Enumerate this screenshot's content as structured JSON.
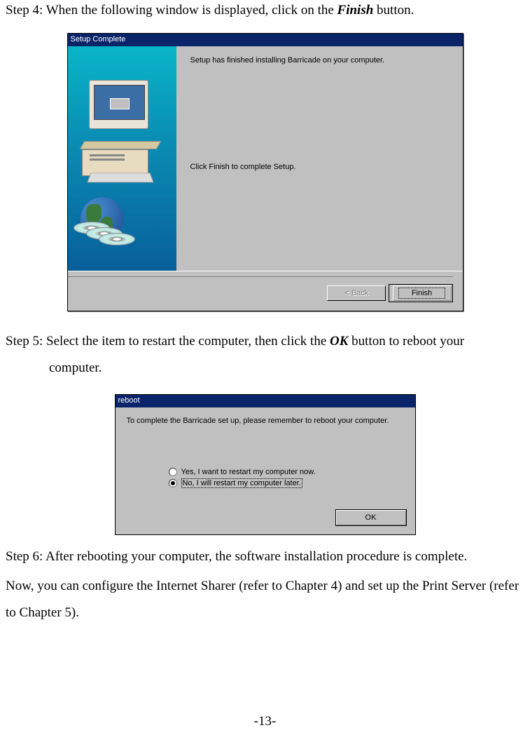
{
  "step4": {
    "prefix": "Step 4: When the following window is displayed, click on the ",
    "action": "Finish",
    "suffix": " button."
  },
  "dialog1": {
    "title": "Setup Complete",
    "msg1": "Setup has finished installing Barricade on your computer.",
    "msg2": "Click Finish to complete Setup.",
    "back_label": "< Back",
    "finish_label": "Finish"
  },
  "step5": {
    "prefix": "Step 5: Select the item to restart the computer, then click the ",
    "action": "OK",
    "suffix": " button to reboot your",
    "line2": "computer."
  },
  "dialog2": {
    "title": "reboot",
    "msg": "To complete the Barricade set up, please remember to reboot your computer.",
    "radio1": "Yes, I want to restart my computer now.",
    "radio2": "No, I will restart my computer later.",
    "ok_label": "OK"
  },
  "step6": "Step 6: After rebooting your computer, the software installation procedure is complete.",
  "final": "Now, you can configure the Internet Sharer (refer to Chapter 4) and set up the Print Server (refer to Chapter 5).",
  "page_number": "-13-"
}
